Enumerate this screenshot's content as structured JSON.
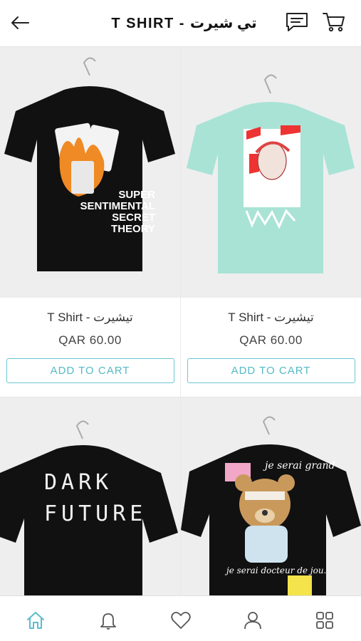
{
  "header": {
    "title": "T SHIRT  -  تي شيرت",
    "icons": [
      "back-arrow-icon",
      "chat-icon",
      "cart-icon"
    ]
  },
  "products": [
    {
      "name": "T Shirt  -  تيشيرت",
      "price": "QAR 60.00",
      "button": "ADD TO CART",
      "shirt_color": "#111111",
      "print_text": [
        "SUPER",
        "SENTIMENTAL",
        "SECRET",
        "THEORY"
      ]
    },
    {
      "name": "T Shirt  -  تيشيرت",
      "price": "QAR 60.00",
      "button": "ADD TO CART",
      "shirt_color": "#a9e3d6"
    },
    {
      "shirt_color": "#111111",
      "print_text": [
        "DARK",
        "FUTURE"
      ]
    },
    {
      "shirt_color": "#111111",
      "print_text": [
        "je serai grand",
        "je serai docteur de jou."
      ]
    }
  ],
  "bottom_nav": {
    "items": [
      "home-icon",
      "bell-icon",
      "heart-icon",
      "user-icon",
      "grid-icon"
    ],
    "active_color": "#5bbccb",
    "inactive_color": "#555555"
  }
}
